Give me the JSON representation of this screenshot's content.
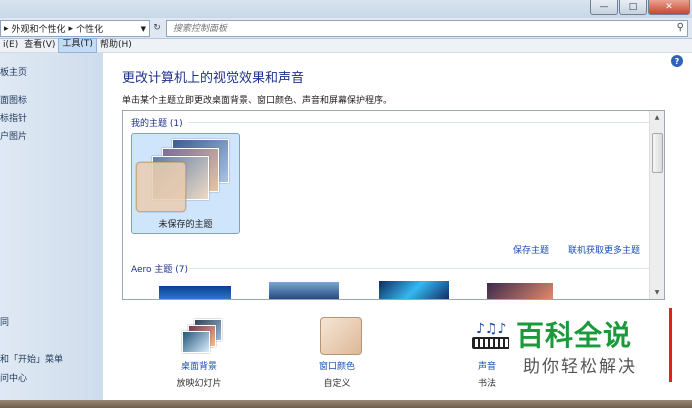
{
  "window": {
    "breadcrumb": [
      "外观和个性化",
      "个性化"
    ],
    "breadcrumb_sep": "▸",
    "search_placeholder": "搜索控制面板",
    "buttons": {
      "minimize": "—",
      "maximize": "□",
      "close": "✕"
    }
  },
  "menu": [
    "i(E)",
    "查看(V)",
    "工具(T)",
    "帮助(H)"
  ],
  "sidebar": {
    "items": [
      "板主页",
      "面图标",
      "标指针",
      "户图片",
      "同",
      "和「开始」菜单",
      "问中心"
    ]
  },
  "main": {
    "title": "更改计算机上的视觉效果和声音",
    "description": "单击某个主题立即更改桌面背景、窗口颜色、声音和屏幕保护程序。",
    "my_themes_label": "我的主题 (1)",
    "unsaved_theme": "未保存的主题",
    "save_theme": "保存主题",
    "get_more": "联机获取更多主题",
    "aero_label": "Aero 主题 (7)"
  },
  "bottom": [
    {
      "label": "桌面背景",
      "sub": "放映幻灯片"
    },
    {
      "label": "窗口颜色",
      "sub": "自定义"
    },
    {
      "label": "声音",
      "sub": "书法"
    }
  ],
  "watermark": {
    "big": "百科全说",
    "small": "助你轻松解决"
  },
  "colors": {
    "accent": "#1e3287",
    "link": "#1a4fb0",
    "selection": "#cfe5fc"
  }
}
